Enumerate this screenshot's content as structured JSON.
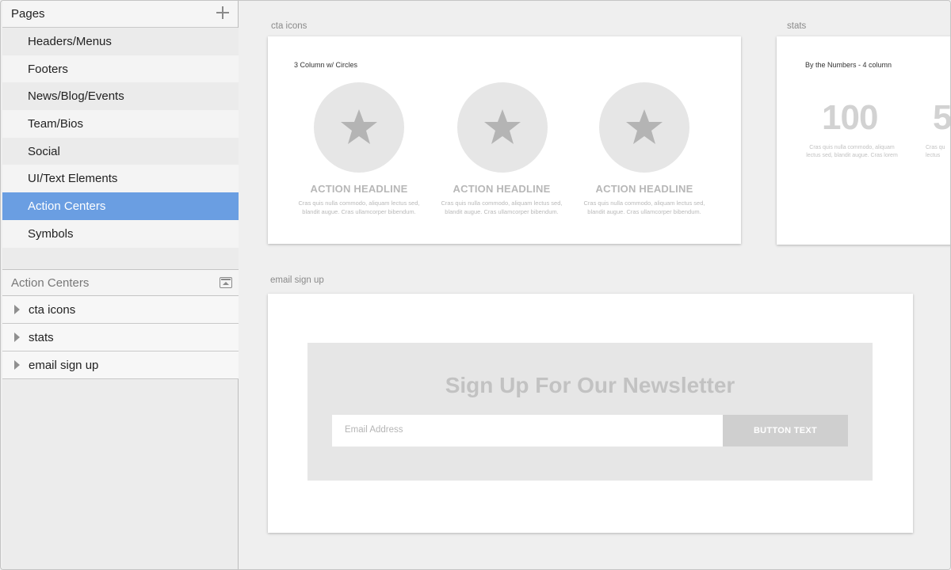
{
  "pages_panel": {
    "title": "Pages",
    "items": [
      {
        "label": "Headers/Menus"
      },
      {
        "label": "Footers"
      },
      {
        "label": "News/Blog/Events"
      },
      {
        "label": "Team/Bios"
      },
      {
        "label": "Social"
      },
      {
        "label": "UI/Text Elements"
      },
      {
        "label": "Action Centers"
      },
      {
        "label": "Symbols"
      }
    ],
    "selected": "Action Centers"
  },
  "layers_panel": {
    "title": "Action Centers",
    "items": [
      {
        "label": "cta icons",
        "icon": "disclosure-triangle-icon"
      },
      {
        "label": "stats",
        "icon": "disclosure-triangle-icon"
      },
      {
        "label": "email sign up",
        "icon": "disclosure-triangle-icon"
      }
    ]
  },
  "canvas": {
    "cta_icons": {
      "label": "cta icons",
      "subtitle": "3 Column w/ Circles",
      "columns": [
        {
          "icon": "star-icon",
          "headline": "ACTION HEADLINE",
          "body1": "Cras quis nulla commodo, aliquam lectus sed,",
          "body2": "blandit augue. Cras ullamcorper bibendum."
        },
        {
          "icon": "star-icon",
          "headline": "ACTION HEADLINE",
          "body1": "Cras quis nulla commodo, aliquam lectus sed,",
          "body2": "blandit augue. Cras ullamcorper bibendum."
        },
        {
          "icon": "star-icon",
          "headline": "ACTION HEADLINE",
          "body1": "Cras quis nulla commodo, aliquam lectus sed,",
          "body2": "blandit augue. Cras ullamcorper bibendum."
        }
      ]
    },
    "stats": {
      "label": "stats",
      "subtitle": "By the Numbers - 4 column",
      "stat1": {
        "number": "100",
        "body1": "Cras quis nulla commodo, aliquam",
        "body2": "lectus sed, blandit augue. Cras lorem"
      },
      "stat2": {
        "number": "5",
        "body1": "Cras qu",
        "body2": "lectus"
      }
    },
    "email_sign_up": {
      "label": "email sign up",
      "heading": "Sign Up For Our Newsletter",
      "email_placeholder": "Email Address",
      "button_label": "BUTTON TEXT"
    }
  },
  "colors": {
    "selection": "#6a9ee2",
    "icon_gray": "#b4b4b4",
    "circle_gray": "#e6e6e6"
  }
}
